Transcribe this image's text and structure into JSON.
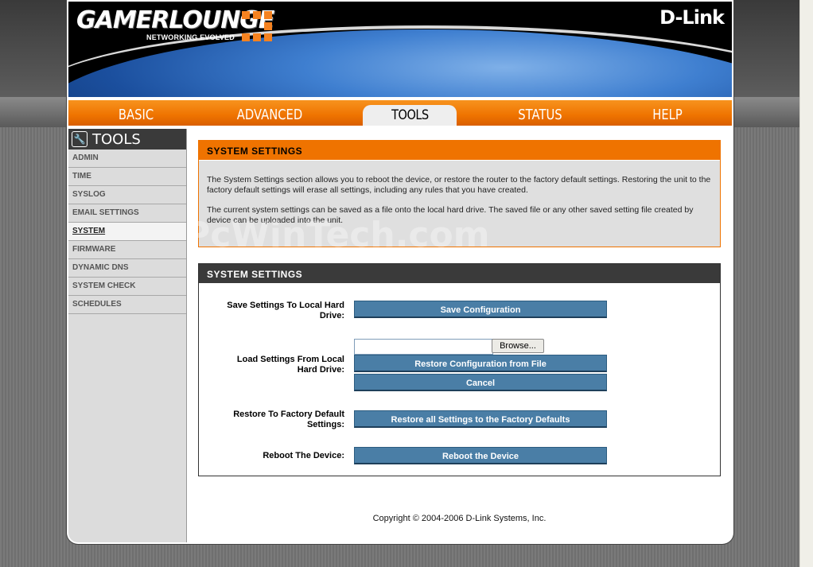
{
  "header": {
    "brand": "GAMERLOUNGE",
    "tagline": "NETWORKING EVOLVED",
    "vendor": "D-Link"
  },
  "tabs": [
    {
      "label": "BASIC"
    },
    {
      "label": "ADVANCED"
    },
    {
      "label": "TOOLS"
    },
    {
      "label": "STATUS"
    },
    {
      "label": "HELP"
    }
  ],
  "sidebar": {
    "title": "TOOLS",
    "items": [
      {
        "label": "ADMIN"
      },
      {
        "label": "TIME"
      },
      {
        "label": "SYSLOG"
      },
      {
        "label": "EMAIL SETTINGS"
      },
      {
        "label": "SYSTEM"
      },
      {
        "label": "FIRMWARE"
      },
      {
        "label": "DYNAMIC DNS"
      },
      {
        "label": "SYSTEM CHECK"
      },
      {
        "label": "SCHEDULES"
      }
    ]
  },
  "info": {
    "title": "SYSTEM SETTINGS",
    "para1": "The System Settings section allows you to reboot the device, or restore the router to the factory default settings. Restoring the unit to the factory default settings will erase all settings, including any rules that you have created.",
    "para2": "The current system settings can be saved as a file onto the local hard drive. The saved file or any other saved setting file created by device can be uploaded into the unit."
  },
  "settings": {
    "title": "SYSTEM SETTINGS",
    "save_label": "Save Settings To Local Hard Drive:",
    "save_button": "Save Configuration",
    "load_label": "Load Settings From Local Hard Drive:",
    "file_value": "",
    "browse_button": "Browse...",
    "restore_file_button": "Restore Configuration from File",
    "cancel_button": "Cancel",
    "factory_label": "Restore To Factory Default Settings:",
    "factory_button": "Restore all Settings to the Factory Defaults",
    "reboot_label": "Reboot The Device:",
    "reboot_button": "Reboot the Device"
  },
  "footer": {
    "copyright": "Copyright © 2004-2006 D-Link Systems, Inc."
  },
  "watermark": "PcWinTech.com",
  "colors": {
    "accent": "#ef7300",
    "button": "#4a7ea6",
    "dark": "#3a3a3a"
  }
}
